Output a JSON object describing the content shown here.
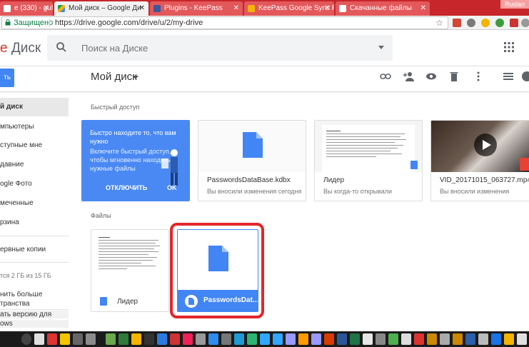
{
  "browser": {
    "tabs": [
      {
        "title": "e (330) - gulovi",
        "favicon_color": "#d44638"
      },
      {
        "title": "Мой диск – Google Ди",
        "favicon_color": "#0f9d58",
        "active": true
      },
      {
        "title": "Plugins - KeePass",
        "favicon_color": "#3b5998"
      },
      {
        "title": "KeePass Google Sync Plu",
        "favicon_color": "#f4b400"
      },
      {
        "title": "Скачанные файлы",
        "favicon_color": "#8ab4f8"
      }
    ],
    "profile": "Ruslan",
    "security_label": "Защищено",
    "url": "https://drive.google.com/drive/u/2/my-drive"
  },
  "header": {
    "logo_fragment": "e",
    "logo_text": "Диск",
    "search_placeholder": "Поиск на Диске"
  },
  "subbar": {
    "new_label": "ть",
    "title": "Мой диск"
  },
  "sidebar": {
    "items": [
      {
        "label": "й диск",
        "active": true
      },
      {
        "label": "мпьютеры"
      },
      {
        "label": "ступные мне"
      },
      {
        "label": "давние"
      },
      {
        "label": "ogle Фото"
      },
      {
        "label": "меченные"
      },
      {
        "label": "рзина"
      }
    ],
    "backup_label": "ервные копии",
    "storage_text": "тся 2 ГБ из 15 ГБ",
    "buy_storage_line1": "нить больше",
    "buy_storage_line2": "транства",
    "download_line1": "ать версию для",
    "download_line2": "ows"
  },
  "quick_access": {
    "title": "Быстрый доступ",
    "promo": {
      "heading": "Быстро находите то, что вам нужно",
      "body": "Включите быстрый доступ, чтобы мгновенно находить нужные файлы",
      "disable": "ОТКЛЮЧИТЬ",
      "ok": "OK"
    },
    "cards": [
      {
        "name": "PasswordsDataBase.kdbx",
        "sub": "Вы вносили изменения сегодня"
      },
      {
        "name": "Лидер",
        "sub": "Вы когда-то открывали"
      },
      {
        "name": "VID_20171015_063727.mp4",
        "sub": "Вы вносили изменения"
      }
    ]
  },
  "files": {
    "title": "Файлы",
    "items": [
      {
        "name": "Лидер"
      },
      {
        "name": "PasswordsDat..."
      }
    ]
  },
  "colors": {
    "chrome_red": "#c7262a",
    "drive_blue": "#4285f4",
    "highlight_red": "#e3262a",
    "docs_blue": "#4285f4"
  }
}
